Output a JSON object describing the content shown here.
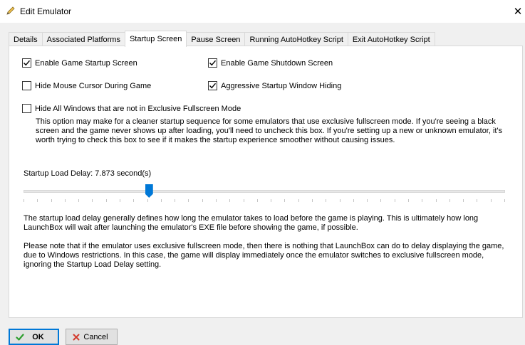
{
  "window": {
    "title": "Edit Emulator",
    "close_symbol": "✕"
  },
  "tabs": [
    {
      "label": "Details"
    },
    {
      "label": "Associated Platforms"
    },
    {
      "label": "Startup Screen"
    },
    {
      "label": "Pause Screen"
    },
    {
      "label": "Running AutoHotkey Script"
    },
    {
      "label": "Exit AutoHotkey Script"
    }
  ],
  "active_tab": "Startup Screen",
  "options": {
    "enable_startup": {
      "label": "Enable Game Startup Screen",
      "checked": true
    },
    "enable_shutdown": {
      "label": "Enable Game Shutdown Screen",
      "checked": true
    },
    "hide_cursor": {
      "label": "Hide Mouse Cursor During Game",
      "checked": false
    },
    "aggressive_hiding": {
      "label": "Aggressive Startup Window Hiding",
      "checked": true
    },
    "hide_windows": {
      "label": "Hide All Windows that are not in Exclusive Fullscreen Mode",
      "checked": false
    }
  },
  "hide_windows_description": "This option may make for a cleaner startup sequence for some emulators that use exclusive fullscreen mode. If you're seeing a black screen and the game never shows up after loading, you'll need to uncheck this box. If you're setting up a new or unknown emulator, it's worth trying to check this box to see if it makes the startup experience smoother without causing issues.",
  "startup_delay": {
    "label": "Startup Load Delay: 7.873 second(s)",
    "slider_fraction": 0.26
  },
  "help_text_1": "The startup load delay generally defines how long the emulator takes to load before the game is playing. This is ultimately how long LaunchBox will wait after launching the emulator's EXE file before showing the game, if possible.",
  "help_text_2": "Please note that if the emulator uses exclusive fullscreen mode, then there is nothing that LaunchBox can do to delay displaying the game, due to Windows restrictions. In this case, the game will display immediately once the emulator switches to exclusive fullscreen mode, ignoring the Startup Load Delay setting.",
  "buttons": {
    "ok": "OK",
    "cancel": "Cancel"
  },
  "icons": {
    "title": "pencil-icon",
    "ok": "checkmark-icon",
    "cancel": "x-icon"
  },
  "colors": {
    "accent": "#0078d7",
    "ok_icon": "#2e9e2e",
    "cancel_icon": "#d33a2c"
  }
}
